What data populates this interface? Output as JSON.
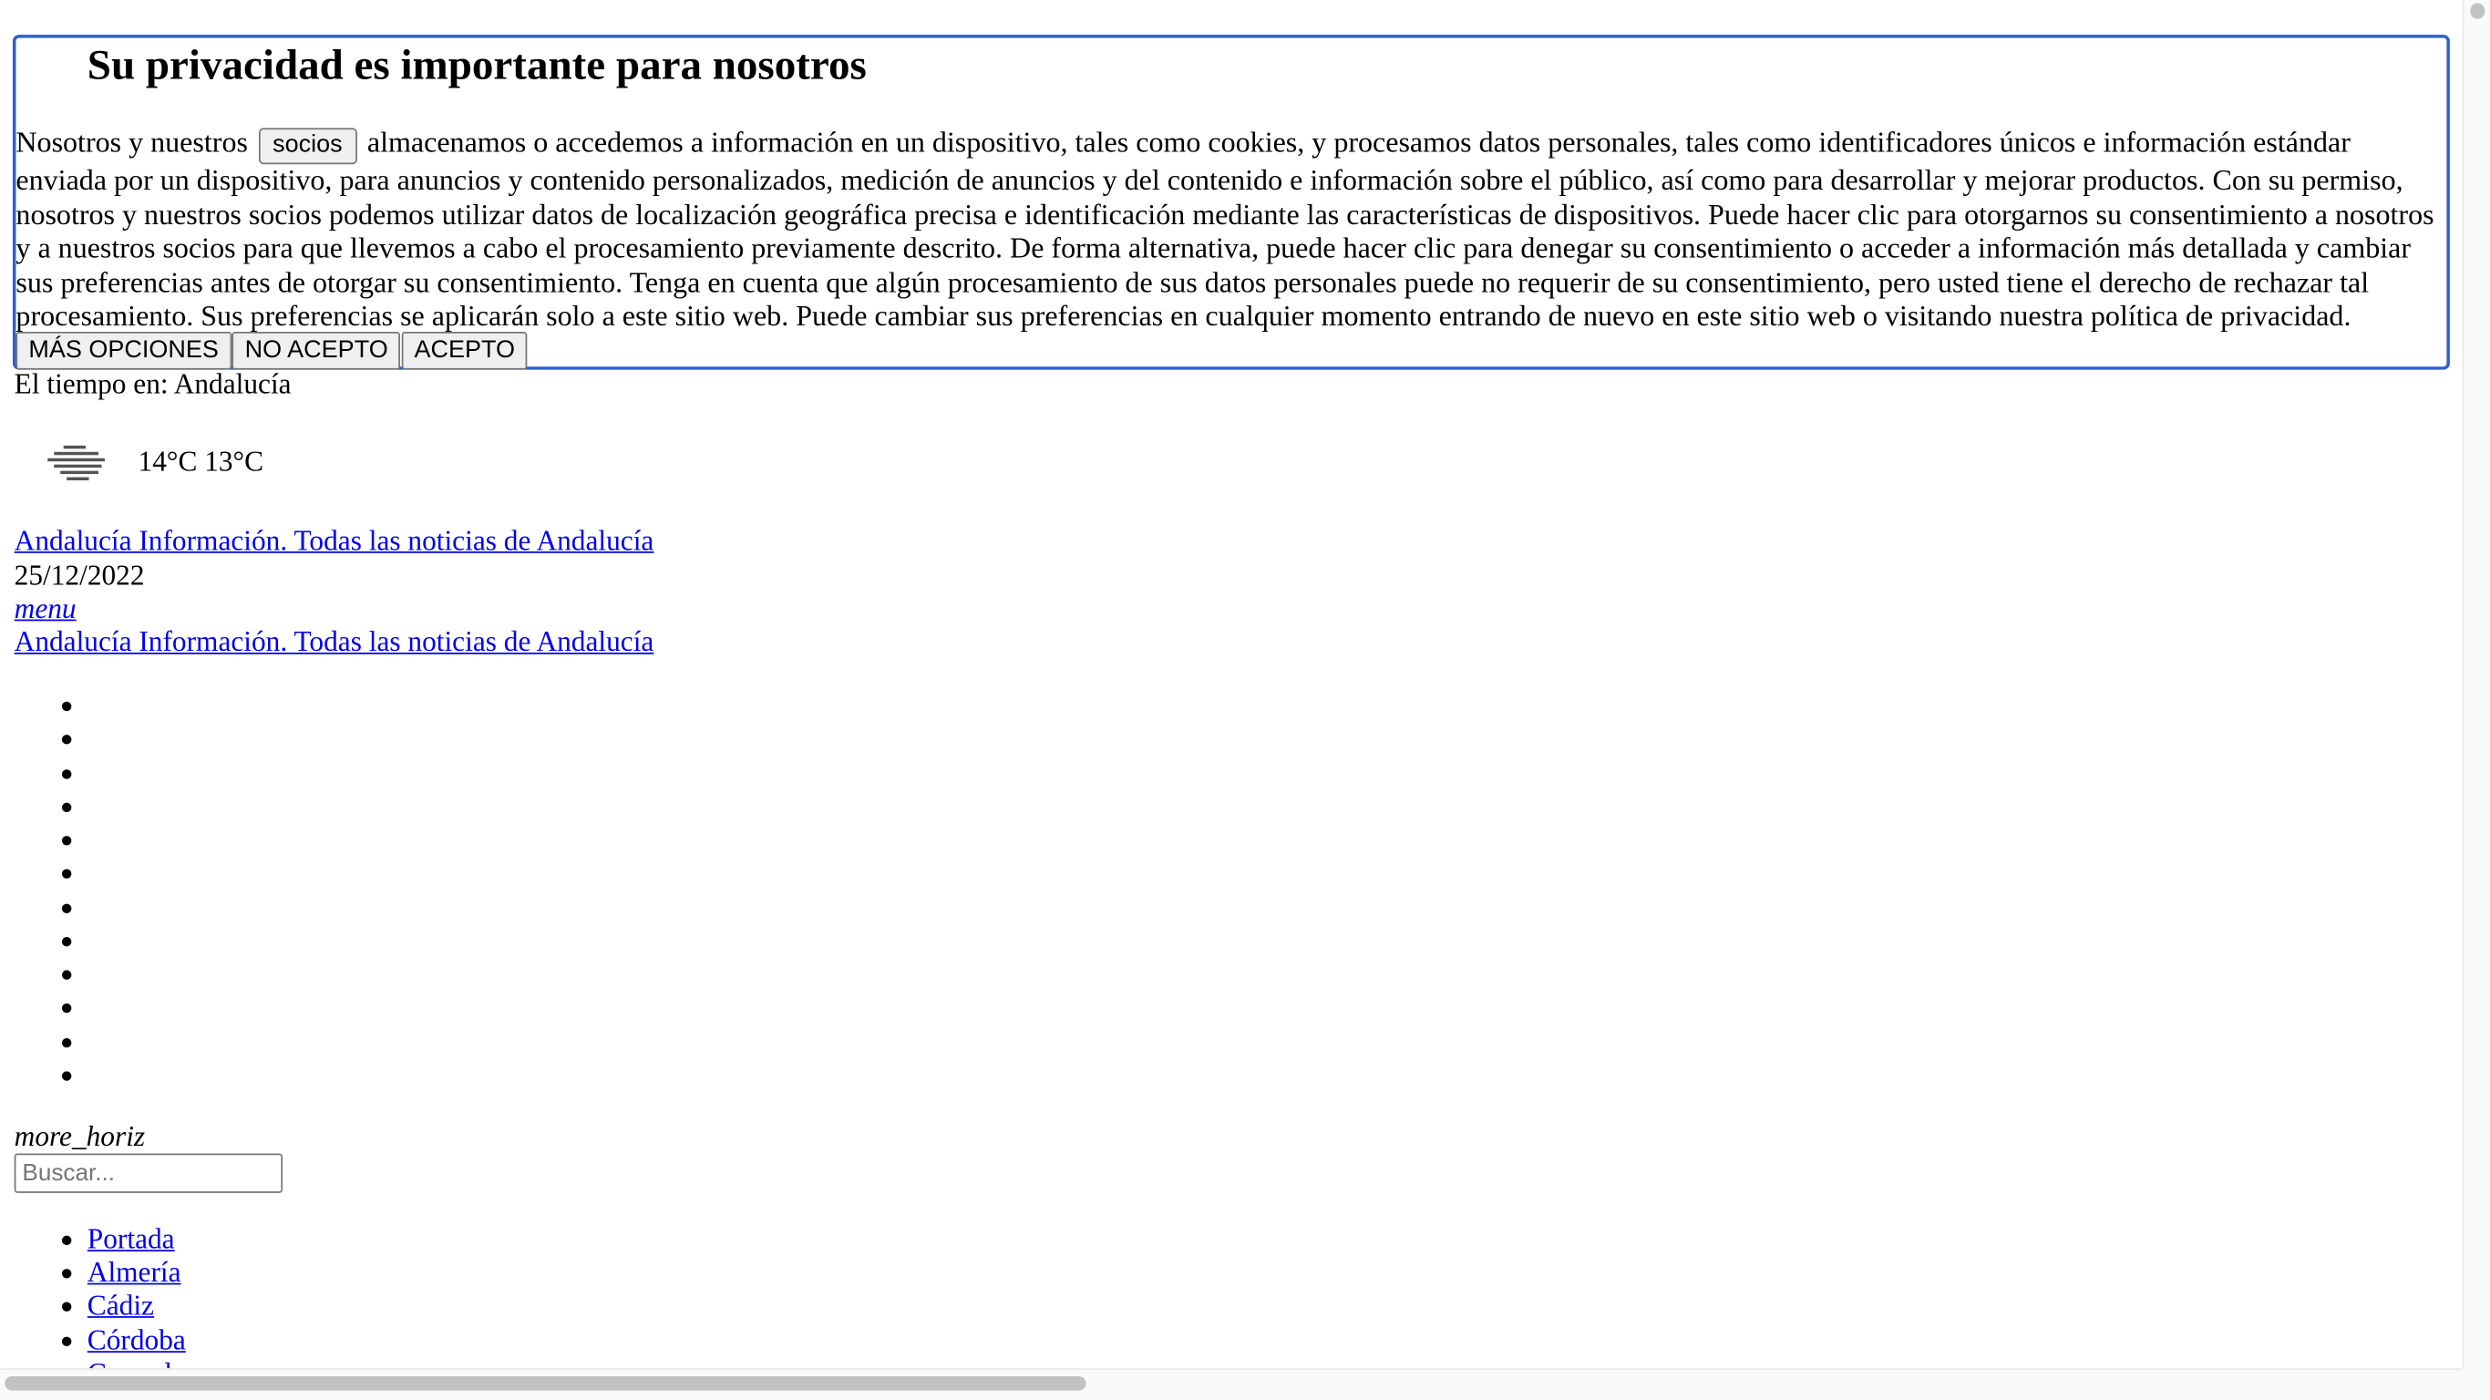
{
  "consent": {
    "title": "Su privacidad es importante para nosotros",
    "text_before": "Nosotros y nuestros",
    "partners_button": "socios",
    "text_after": "almacenamos o accedemos a información en un dispositivo, tales como cookies, y procesamos datos personales, tales como identificadores únicos e información estándar enviada por un dispositivo, para anuncios y contenido personalizados, medición de anuncios y del contenido e información sobre el público, así como para desarrollar y mejorar productos. Con su permiso, nosotros y nuestros socios podemos utilizar datos de localización geográfica precisa e identificación mediante las características de dispositivos. Puede hacer clic para otorgarnos su consentimiento a nosotros y a nuestros socios para que llevemos a cabo el procesamiento previamente descrito. De forma alternativa, puede hacer clic para denegar su consentimiento o acceder a información más detallada y cambiar sus preferencias antes de otorgar su consentimiento. Tenga en cuenta que algún procesamiento de sus datos personales puede no requerir de su consentimiento, pero usted tiene el derecho de rechazar tal procesamiento. Sus preferencias se aplicarán solo a este sitio web. Puede cambiar sus preferencias en cualquier momento entrando de nuevo en este sitio web o visitando nuestra política de privacidad.",
    "more_options": "MÁS OPCIONES",
    "reject": "NO ACEPTO",
    "accept": "ACEPTO"
  },
  "weather": {
    "label": "El tiempo en: Andalucía",
    "temps": "14°C 13°C",
    "icon": "fog-icon"
  },
  "header": {
    "site_link": "Andalucía Información. Todas las noticias de Andalucía",
    "date": "25/12/2022",
    "date_link": " ",
    "menu": "menu",
    "site_link_2": "Andalucía Información. Todas las noticias de Andalucía"
  },
  "empty_bullets": [
    "",
    "",
    "",
    "",
    "",
    "",
    "",
    "",
    "",
    "",
    "",
    ""
  ],
  "more": "more_horiz",
  "search": {
    "placeholder": "Buscar..."
  },
  "nav": [
    {
      "label": "Portada"
    },
    {
      "label": "Almería"
    },
    {
      "label": "Cádiz"
    },
    {
      "label": "Córdoba"
    },
    {
      "label": "Granada"
    }
  ]
}
